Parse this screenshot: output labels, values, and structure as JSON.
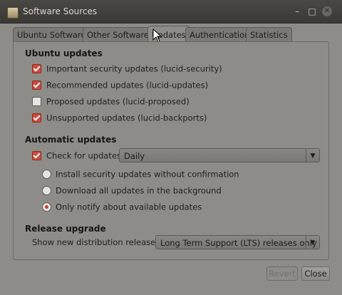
{
  "window": {
    "title": "Software Sources"
  },
  "tabs": [
    {
      "label": "Ubuntu Software"
    },
    {
      "label": "Other Software"
    },
    {
      "label": "Updates"
    },
    {
      "label": "Authentication"
    },
    {
      "label": "Statistics"
    }
  ],
  "ubuntu_updates": {
    "title": "Ubuntu updates",
    "items": [
      {
        "label": "Important security updates (lucid-security)",
        "checked": true
      },
      {
        "label": "Recommended updates (lucid-updates)",
        "checked": true
      },
      {
        "label": "Proposed updates (lucid-proposed)",
        "checked": false
      },
      {
        "label": "Unsupported updates (lucid-backports)",
        "checked": true
      }
    ]
  },
  "automatic_updates": {
    "title": "Automatic updates",
    "check_label": "Check for updates:",
    "check_checked": true,
    "frequency": "Daily",
    "options": [
      {
        "label": "Install security updates without confirmation",
        "selected": false
      },
      {
        "label": "Download all updates in the background",
        "selected": false
      },
      {
        "label": "Only notify about available updates",
        "selected": true
      }
    ]
  },
  "release_upgrade": {
    "title": "Release upgrade",
    "label": "Show new distribution releases:",
    "value": "Long Term Support (LTS) releases only"
  },
  "buttons": {
    "revert": "Revert",
    "close": "Close"
  },
  "colors": {
    "accent": "#d04a3c",
    "window_bg": "#8e8c89",
    "titlebar": "#3b3935"
  }
}
